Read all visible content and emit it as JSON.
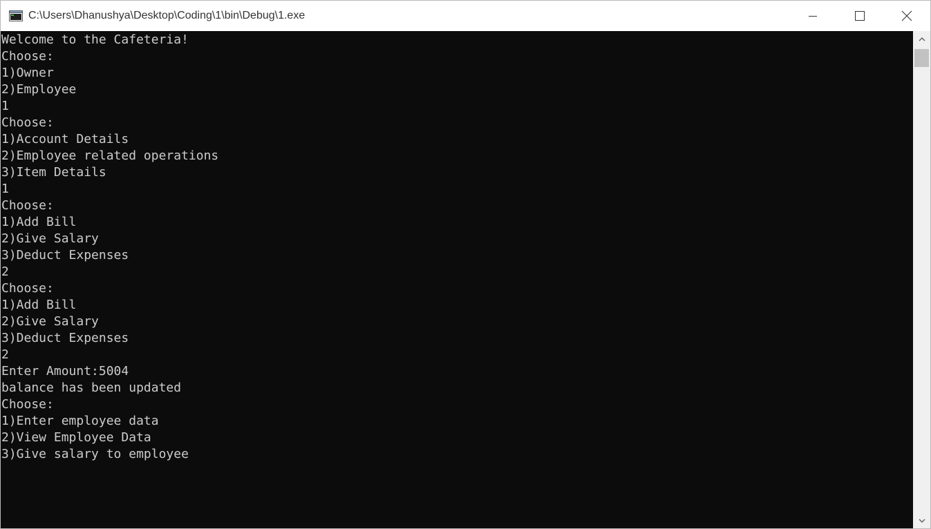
{
  "window": {
    "title": "C:\\Users\\Dhanushya\\Desktop\\Coding\\1\\bin\\Debug\\1.exe",
    "icon": "console-app-icon"
  },
  "caption_buttons": {
    "minimize": "minimize-icon",
    "maximize": "maximize-icon",
    "close": "close-icon"
  },
  "console": {
    "text_color": "#cccccc",
    "background": "#0c0c0c",
    "lines": [
      "Welcome to the Cafeteria!",
      "Choose:",
      "1)Owner",
      "2)Employee",
      "1",
      "Choose:",
      "1)Account Details",
      "2)Employee related operations",
      "3)Item Details",
      "1",
      "Choose:",
      "1)Add Bill",
      "2)Give Salary",
      "3)Deduct Expenses",
      "2",
      "Choose:",
      "1)Add Bill",
      "2)Give Salary",
      "3)Deduct Expenses",
      "2",
      "Enter Amount:5004",
      "balance has been updated",
      "Choose:",
      "1)Enter employee data",
      "2)View Employee Data",
      "3)Give salary to employee"
    ]
  },
  "scrollbar": {
    "up": "scroll-up-arrow-icon",
    "down": "scroll-down-arrow-icon"
  }
}
